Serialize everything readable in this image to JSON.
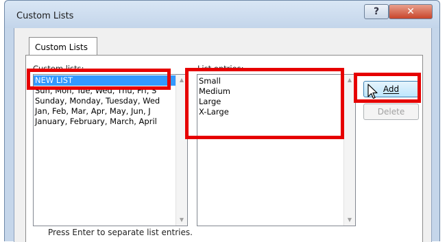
{
  "window": {
    "title": "Custom Lists",
    "help_glyph": "?",
    "close_glyph": "✕"
  },
  "tab": {
    "label": "Custom Lists"
  },
  "custom_lists": {
    "label": "Custom lists:",
    "items": [
      {
        "text": "NEW LIST",
        "selected": true
      },
      {
        "text": "Sun, Mon, Tue, Wed, Thu, Fri, S",
        "selected": false
      },
      {
        "text": "Sunday, Monday, Tuesday, Wed",
        "selected": false
      },
      {
        "text": "Jan, Feb, Mar, Apr, May, Jun, J",
        "selected": false
      },
      {
        "text": "January, February, March, April",
        "selected": false
      }
    ]
  },
  "list_entries": {
    "label": "List entries:",
    "items": [
      "Small",
      "Medium",
      "Large",
      "X-Large"
    ]
  },
  "buttons": {
    "add": "Add",
    "delete": "Delete"
  },
  "hint": "Press Enter to separate list entries.",
  "colors": {
    "highlight": "#e60000",
    "selection": "#3399ff"
  },
  "icons": {
    "cursor": "mouse-pointer-icon"
  }
}
